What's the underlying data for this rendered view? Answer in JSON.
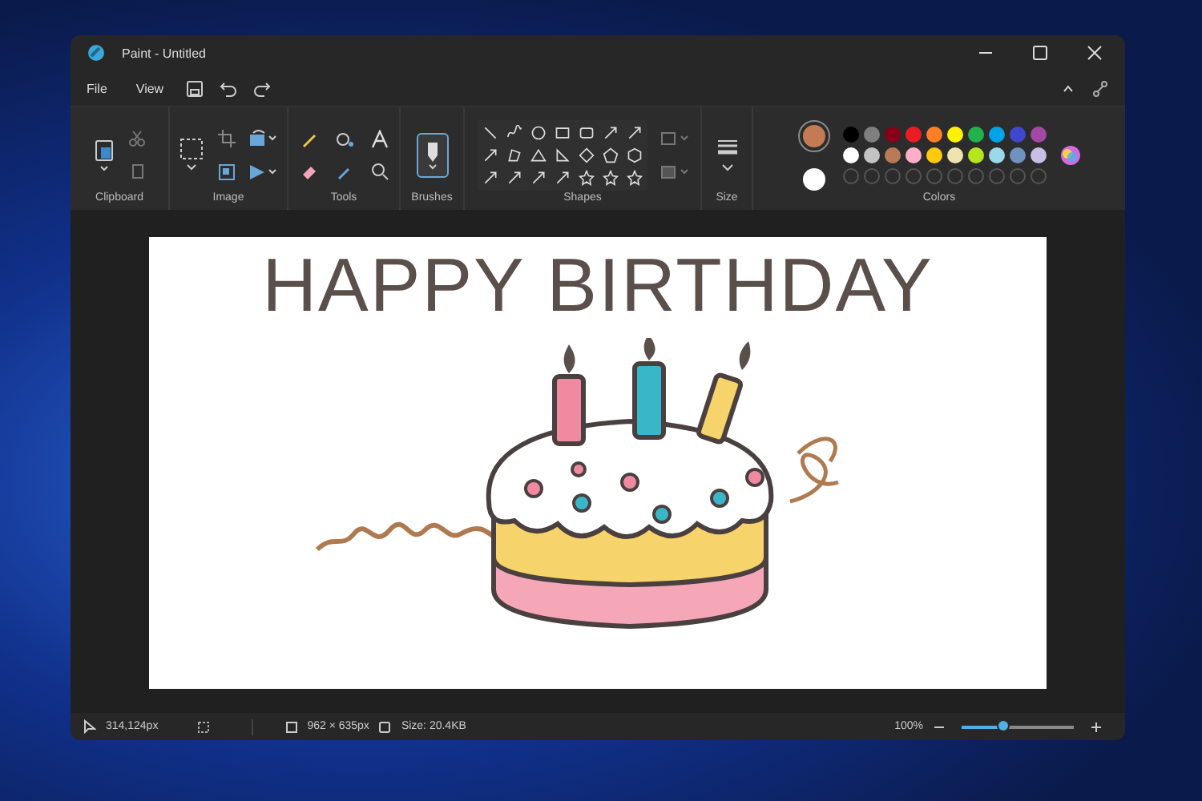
{
  "window": {
    "title": "Paint - Untitled"
  },
  "menu": [
    {
      "label": "File"
    },
    {
      "label": "View"
    }
  ],
  "ribbon_groups": [
    {
      "label": "Clipboard"
    },
    {
      "label": "Image"
    },
    {
      "label": "Tools"
    },
    {
      "label": "Brushes"
    },
    {
      "label": "Shapes"
    },
    {
      "label": "Size"
    },
    {
      "label": "Colors"
    }
  ],
  "colors": {
    "primary": {
      "color": "#c47a55"
    },
    "secondary": {
      "color": "#ffffff"
    },
    "palette": [
      {
        "color": "#000000"
      },
      {
        "color": "#7f7f7f"
      },
      {
        "color": "#880015"
      },
      {
        "color": "#ed1c24"
      },
      {
        "color": "#ff7f27"
      },
      {
        "color": "#fff200"
      },
      {
        "color": "#22b14c"
      },
      {
        "color": "#00a2e8"
      },
      {
        "color": "#3f48cc"
      },
      {
        "color": "#a349a4"
      },
      {
        "color": "#ffffff"
      },
      {
        "color": "#c3c3c3"
      },
      {
        "color": "#b97a57"
      },
      {
        "color": "#ffaec9"
      },
      {
        "color": "#ffc90e"
      },
      {
        "color": "#efe4b0"
      },
      {
        "color": "#b5e61d"
      },
      {
        "color": "#99d9ea"
      },
      {
        "color": "#7092be"
      },
      {
        "color": "#c8bfe7"
      }
    ]
  },
  "canvas": {
    "text": "HAPPY BIRTHDAY"
  },
  "status_bar": {
    "cursor": "314,124px",
    "canvas_size": "962 × 635px",
    "file_size": "Size: 20.4KB",
    "zoom": "100%",
    "zoom_slider": {
      "level": 0.37
    }
  }
}
